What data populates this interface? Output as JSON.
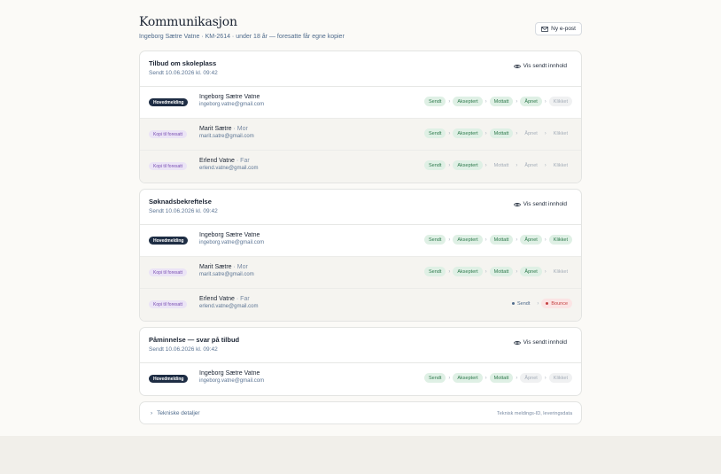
{
  "header": {
    "title": "Kommunikasjon",
    "subtitle": "Ingeborg Sætre Vatne · KM-2614 · under 18 år — foresatte får egne kopier",
    "new_mail_label": "Ny e-post"
  },
  "labels": {
    "view_sent": "Vis sendt innhold",
    "sep": "›"
  },
  "colors": {
    "main_badge": "#1e2d44",
    "copy_badge": "#ebe4f6",
    "done": "#dff0e5",
    "bounce": "#fbe4e4"
  },
  "sections": [
    {
      "title": "Tilbud om skoleplass",
      "date": "Sendt 10.06.2026 kl. 09:42",
      "rows": [
        {
          "type": "main",
          "role": "Hovedmelding",
          "name": "Ingeborg Sætre Vatne",
          "relation": "",
          "email": "ingeborg.vatne@gmail.com",
          "statuses": [
            {
              "label": "Sendt",
              "state": "done"
            },
            {
              "label": "Akseptert",
              "state": "done"
            },
            {
              "label": "Mottatt",
              "state": "done"
            },
            {
              "label": "Åpnet",
              "state": "done"
            },
            {
              "label": "Klikket",
              "state": "pending-box"
            }
          ]
        },
        {
          "type": "copy",
          "role": "Kopi til foresatt",
          "name": "Marit Sætre",
          "relation": "· Mor",
          "email": "marit.satre@gmail.com",
          "statuses": [
            {
              "label": "Sendt",
              "state": "done"
            },
            {
              "label": "Akseptert",
              "state": "done"
            },
            {
              "label": "Mottatt",
              "state": "done"
            },
            {
              "label": "Åpnet",
              "state": "pending"
            },
            {
              "label": "Klikket",
              "state": "pending"
            }
          ]
        },
        {
          "type": "copy",
          "role": "Kopi til foresatt",
          "name": "Erlend Vatne",
          "relation": "· Far",
          "email": "erlend.vatne@gmail.com",
          "statuses": [
            {
              "label": "Sendt",
              "state": "done"
            },
            {
              "label": "Akseptert",
              "state": "done"
            },
            {
              "label": "Mottatt",
              "state": "pending"
            },
            {
              "label": "Åpnet",
              "state": "pending"
            },
            {
              "label": "Klikket",
              "state": "pending"
            }
          ]
        }
      ]
    },
    {
      "title": "Søknadsbekreftelse",
      "date": "Sendt 10.06.2026 kl. 09:42",
      "rows": [
        {
          "type": "main",
          "role": "Hovedmelding",
          "name": "Ingeborg Sætre Vatne",
          "relation": "",
          "email": "ingeborg.vatne@gmail.com",
          "statuses": [
            {
              "label": "Sendt",
              "state": "done"
            },
            {
              "label": "Akseptert",
              "state": "done"
            },
            {
              "label": "Mottatt",
              "state": "done"
            },
            {
              "label": "Åpnet",
              "state": "done"
            },
            {
              "label": "Klikket",
              "state": "done"
            }
          ]
        },
        {
          "type": "copy",
          "role": "Kopi til foresatt",
          "name": "Marit Sætre",
          "relation": "· Mor",
          "email": "marit.satre@gmail.com",
          "statuses": [
            {
              "label": "Sendt",
              "state": "done"
            },
            {
              "label": "Akseptert",
              "state": "done"
            },
            {
              "label": "Mottatt",
              "state": "done"
            },
            {
              "label": "Åpnet",
              "state": "done"
            },
            {
              "label": "Klikket",
              "state": "pending"
            }
          ]
        },
        {
          "type": "copy",
          "role": "Kopi til foresatt",
          "name": "Erlend Vatne",
          "relation": "· Far",
          "email": "erlend.vatne@gmail.com",
          "statuses": [
            {
              "label": "Sendt",
              "state": "dot"
            },
            {
              "label": "Bounce",
              "state": "bounce"
            }
          ]
        }
      ]
    },
    {
      "title": "Påminnelse — svar på tilbud",
      "date": "Sendt 10.06.2026 kl. 09:42",
      "rows": [
        {
          "type": "main",
          "role": "Hovedmelding",
          "name": "Ingeborg Sætre Vatne",
          "relation": "",
          "email": "ingeborg.vatne@gmail.com",
          "statuses": [
            {
              "label": "Sendt",
              "state": "done"
            },
            {
              "label": "Akseptert",
              "state": "done"
            },
            {
              "label": "Mottatt",
              "state": "done"
            },
            {
              "label": "Åpnet",
              "state": "pending-box"
            },
            {
              "label": "Klikket",
              "state": "pending-box"
            }
          ]
        }
      ]
    }
  ],
  "technical": {
    "label": "Tekniske detaljer",
    "hint": "Teknisk meldings-ID, leveringsdata",
    "chevron": "›"
  }
}
